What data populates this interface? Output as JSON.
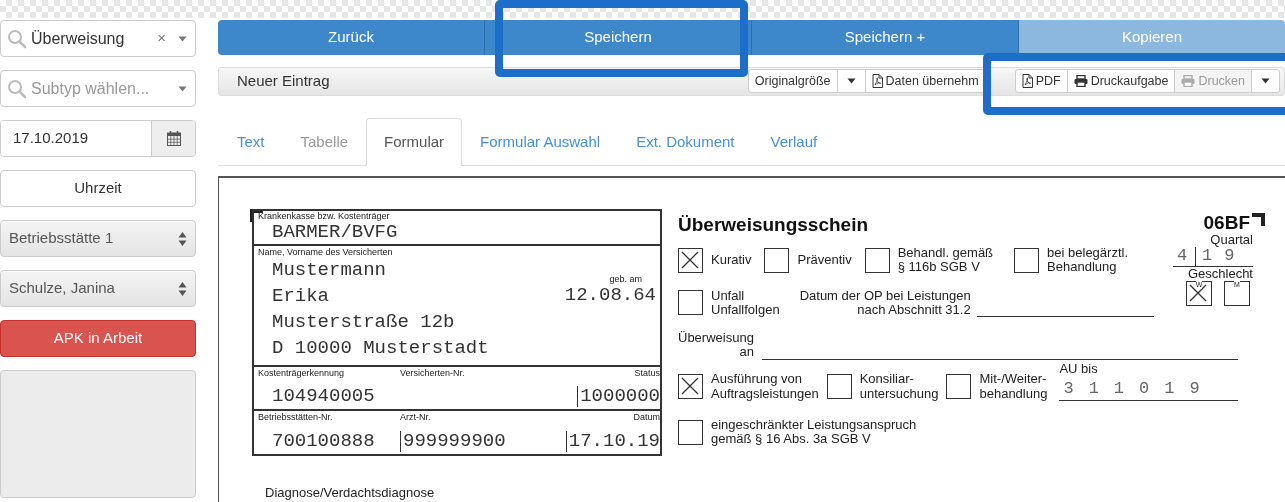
{
  "sidebar": {
    "document_type": {
      "value": "Überweisung",
      "clear": "×"
    },
    "subtype": {
      "placeholder": "Subtyp wählen..."
    },
    "date": {
      "value": "17.10.2019"
    },
    "time_button": "Uhrzeit",
    "location": {
      "value": "Betriebsstätte 1"
    },
    "doctor": {
      "value": "Schulze, Janina"
    },
    "status_button": "APK in Arbeit"
  },
  "action_buttons": [
    {
      "label": "Zurück",
      "disabled": false
    },
    {
      "label": "Speichern",
      "disabled": false
    },
    {
      "label": "Speichern +",
      "disabled": false
    },
    {
      "label": "Kopieren",
      "disabled": true
    }
  ],
  "toolbar": {
    "title": "Neuer Eintrag",
    "groups": [
      {
        "buttons": [
          {
            "kind": "text",
            "label": "Originalgröße",
            "disabled": false
          },
          {
            "kind": "caret"
          },
          {
            "kind": "pdf",
            "label": "Daten übernehm",
            "disabled": false
          }
        ]
      },
      {
        "buttons": [
          {
            "kind": "pdf",
            "label": "PDF",
            "disabled": false
          },
          {
            "kind": "print",
            "label": "Druckaufgabe",
            "disabled": false
          },
          {
            "kind": "print",
            "label": "Drucken",
            "disabled": true
          },
          {
            "kind": "caret"
          }
        ]
      }
    ]
  },
  "tabs": [
    {
      "label": "Text",
      "selected": false,
      "disabled": false
    },
    {
      "label": "Tabelle",
      "selected": false,
      "disabled": true
    },
    {
      "label": "Formular",
      "selected": true,
      "disabled": false
    },
    {
      "label": "Formular Auswahl",
      "selected": false,
      "disabled": false
    },
    {
      "label": "Ext. Dokument",
      "selected": false,
      "disabled": false
    },
    {
      "label": "Verlauf",
      "selected": false,
      "disabled": false
    }
  ],
  "form": {
    "insurer": {
      "label": "Krankenkasse bzw. Kostenträger",
      "value": "BARMER/BVFG"
    },
    "insured": {
      "label": "Name, Vorname des Versicherten",
      "lines": [
        "Mustermann",
        "Erika",
        "Musterstraße 12b",
        "D 10000 Musterstadt"
      ],
      "birth_label": "geb. am",
      "birth_date": "12.08.64"
    },
    "id_rows": [
      {
        "cells": [
          {
            "label": "Kostenträgerkennung",
            "value": "104940005"
          },
          {
            "label": "Versicherten-Nr."
          },
          {
            "label": "Status",
            "value": "1000000"
          }
        ]
      },
      {
        "cells": [
          {
            "label": "Betriebsstätten-Nr.",
            "value": "700100888"
          },
          {
            "label": "Arzt-Nr.",
            "value": "999999900"
          },
          {
            "label": "Datum",
            "value": "17.10.19"
          }
        ]
      }
    ],
    "diagnosis_label": "Diagnose/Verdachtsdiagnose",
    "title": "Überweisungsschein",
    "code": "06BF",
    "quarter": {
      "label": "Quartal",
      "quarter": "4",
      "year": "19"
    },
    "treatment_options": [
      {
        "label": "Kurativ",
        "checked": true
      },
      {
        "label": "Präventiv",
        "checked": false
      },
      {
        "label": "Behandl. gemäß\n§ 116b SGB V",
        "checked": false
      },
      {
        "label": "bei belegärztl.\nBehandlung",
        "checked": false
      }
    ],
    "accident": {
      "label": "Unfall\nUnfallfolgen",
      "checked": false
    },
    "op_date": {
      "label": "Datum der OP bei Leistungen\nnach Abschnitt 31.2"
    },
    "sex": {
      "label": "Geschlecht",
      "options": [
        {
          "label": "W",
          "checked": true
        },
        {
          "label": "M",
          "checked": false
        }
      ]
    },
    "referral": {
      "label": "Überweisung\nan"
    },
    "referral_types": [
      {
        "label": "Ausführung von\nAuftragsleistungen",
        "checked": true
      },
      {
        "label": "Konsiliar-\nuntersuchung",
        "checked": false
      },
      {
        "label": "Mit-/Weiter-\nbehandlung",
        "checked": false
      }
    ],
    "au": {
      "label": "AU bis",
      "value": "311019"
    },
    "restricted": {
      "label": "eingeschränkter Leistungsanspruch\ngemäß § 16 Abs. 3a SGB V",
      "checked": false
    }
  }
}
